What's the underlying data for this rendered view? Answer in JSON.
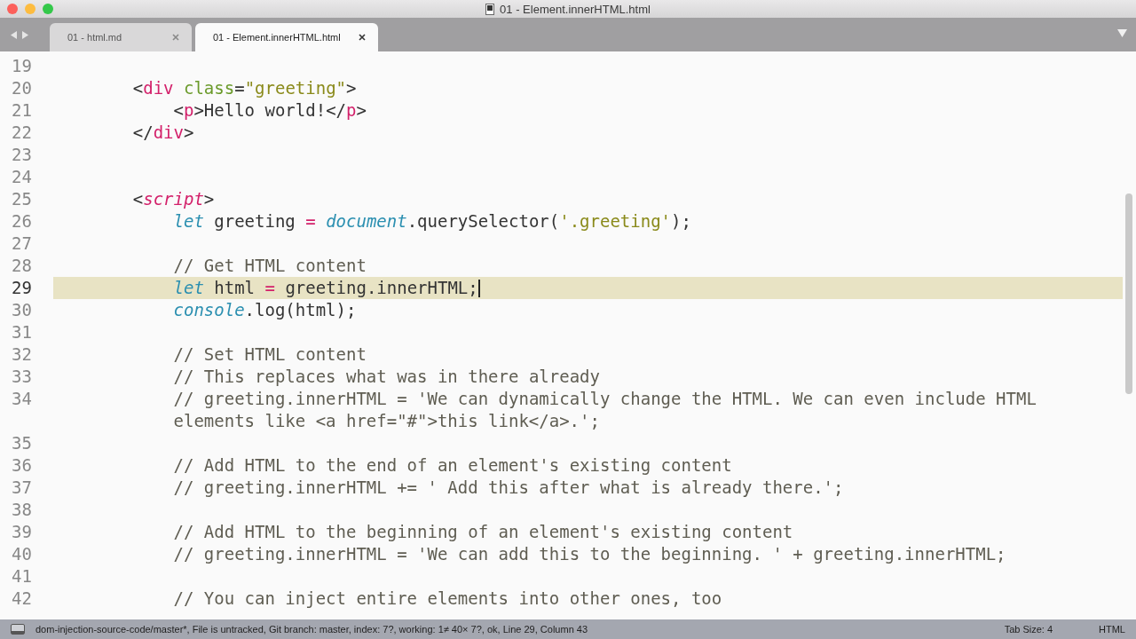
{
  "window": {
    "title": "01 - Element.innerHTML.html"
  },
  "tabs": [
    {
      "label": "01 - html.md",
      "selected": false
    },
    {
      "label": "01 - Element.innerHTML.html",
      "selected": true
    }
  ],
  "editor": {
    "lines": [
      {
        "number": "19",
        "current": false
      },
      {
        "number": "20",
        "current": false,
        "tokens": [
          {
            "kind": "plain",
            "text": "    <"
          },
          {
            "kind": "tag",
            "text": "div"
          },
          {
            "kind": "attr",
            "text": " class"
          },
          {
            "kind": "plain",
            "text": "="
          },
          {
            "kind": "string",
            "text": "\"greeting\""
          },
          {
            "kind": "plain",
            "text": ">"
          }
        ]
      },
      {
        "number": "21",
        "current": false,
        "tokens": [
          {
            "kind": "plain",
            "text": "        <"
          },
          {
            "kind": "tag",
            "text": "p"
          },
          {
            "kind": "plain",
            "text": ">Hello world!</"
          },
          {
            "kind": "tag",
            "text": "p"
          },
          {
            "kind": "plain",
            "text": ">"
          }
        ]
      },
      {
        "number": "22",
        "current": false,
        "tokens": [
          {
            "kind": "plain",
            "text": "    </"
          },
          {
            "kind": "tag",
            "text": "div"
          },
          {
            "kind": "plain",
            "text": ">"
          }
        ]
      },
      {
        "number": "23",
        "current": false
      },
      {
        "number": "24",
        "current": false
      },
      {
        "number": "25",
        "current": false,
        "tokens": [
          {
            "kind": "plain",
            "text": "    <"
          },
          {
            "kind": "script-tag",
            "text": "script"
          },
          {
            "kind": "plain",
            "text": ">"
          }
        ]
      },
      {
        "number": "26",
        "current": false,
        "tokens": [
          {
            "kind": "keyword",
            "text": "        let"
          },
          {
            "kind": "plain",
            "text": " greeting "
          },
          {
            "kind": "operator",
            "text": "="
          },
          {
            "kind": "builtin",
            "text": " document"
          },
          {
            "kind": "plain",
            "text": ".querySelector("
          },
          {
            "kind": "string",
            "text": "'.greeting'"
          },
          {
            "kind": "plain",
            "text": ");"
          }
        ]
      },
      {
        "number": "27",
        "current": false
      },
      {
        "number": "28",
        "current": false,
        "tokens": [
          {
            "kind": "comment",
            "text": "        // Get HTML content"
          }
        ]
      },
      {
        "number": "29",
        "current": true,
        "tokens": [
          {
            "kind": "keyword",
            "text": "        let"
          },
          {
            "kind": "plain",
            "text": " html "
          },
          {
            "kind": "operator",
            "text": "="
          },
          {
            "kind": "plain",
            "text": " greeting.innerHTML;"
          }
        ]
      },
      {
        "number": "30",
        "current": false,
        "tokens": [
          {
            "kind": "builtin",
            "text": "        console"
          },
          {
            "kind": "plain",
            "text": ".log(html);"
          }
        ]
      },
      {
        "number": "31",
        "current": false
      },
      {
        "number": "32",
        "current": false,
        "tokens": [
          {
            "kind": "comment",
            "text": "        // Set HTML content"
          }
        ]
      },
      {
        "number": "33",
        "current": false,
        "tokens": [
          {
            "kind": "comment",
            "text": "        // This replaces what was in there already"
          }
        ]
      },
      {
        "number": "34",
        "current": false,
        "tokens": [
          {
            "kind": "comment",
            "text": "        // greeting.innerHTML = 'We can dynamically change the HTML. We can even include HTML elements like <a href=\"#\">this link</a>.';"
          }
        ]
      },
      {
        "number": "35",
        "current": false
      },
      {
        "number": "36",
        "current": false,
        "tokens": [
          {
            "kind": "comment",
            "text": "        // Add HTML to the end of an element's existing content"
          }
        ]
      },
      {
        "number": "37",
        "current": false,
        "tokens": [
          {
            "kind": "comment",
            "text": "        // greeting.innerHTML += ' Add this after what is already there.';"
          }
        ]
      },
      {
        "number": "38",
        "current": false
      },
      {
        "number": "39",
        "current": false,
        "tokens": [
          {
            "kind": "comment",
            "text": "        // Add HTML to the beginning of an element's existing content"
          }
        ]
      },
      {
        "number": "40",
        "current": false,
        "tokens": [
          {
            "kind": "comment",
            "text": "        // greeting.innerHTML = 'We can add this to the beginning. ' + greeting.innerHTML;"
          }
        ]
      },
      {
        "number": "41",
        "current": false
      },
      {
        "number": "42",
        "current": false,
        "tokens": [
          {
            "kind": "comment",
            "text": "        // You can inject entire elements into other ones, too"
          }
        ]
      }
    ]
  },
  "status_bar": {
    "text": "dom-injection-source-code/master*, File is untracked, Git branch: master, index: 7?, working: 1≠ 40× 7?, ok, Line 29, Column 43",
    "tab_size": "Tab Size: 4",
    "syntax": "HTML"
  }
}
